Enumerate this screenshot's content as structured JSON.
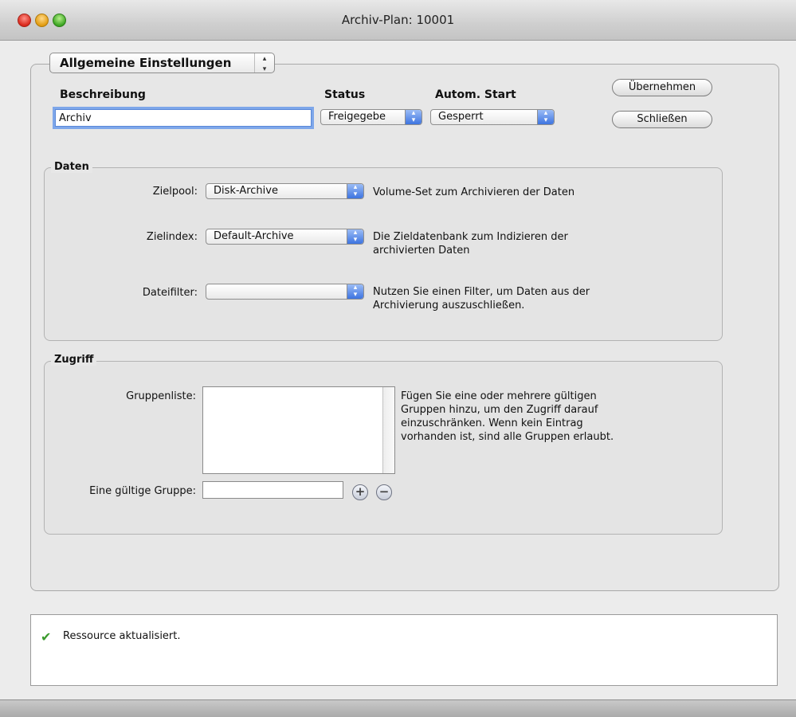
{
  "window": {
    "title": "Archiv-Plan: 10001"
  },
  "section_selector": {
    "value": "Allgemeine Einstellungen"
  },
  "general": {
    "description_label": "Beschreibung",
    "description_value": "Archiv",
    "status_label": "Status",
    "status_value": "Freigegebe",
    "autostart_label": "Autom. Start",
    "autostart_value": "Gesperrt",
    "apply_button": "Übernehmen",
    "close_button": "Schließen"
  },
  "daten": {
    "title": "Daten",
    "zielpool_label": "Zielpool:",
    "zielpool_value": "Disk-Archive",
    "zielpool_desc": "Volume-Set zum Archivieren der Daten",
    "zielindex_label": "Zielindex:",
    "zielindex_value": "Default-Archive",
    "zielindex_desc_line1": "Die Zieldatenbank zum Indizieren der",
    "zielindex_desc_line2": "archivierten Daten",
    "dateifilter_label": "Dateifilter:",
    "dateifilter_value": "",
    "dateifilter_desc_line1": "Nutzen Sie einen Filter, um Daten aus der",
    "dateifilter_desc_line2": "Archivierung auszuschließen."
  },
  "zugriff": {
    "title": "Zugriff",
    "gruppenliste_label": "Gruppenliste:",
    "desc_line1": "Fügen Sie eine oder mehrere gültigen",
    "desc_line2": "Gruppen hinzu, um den Zugriff darauf",
    "desc_line3": "einzuschränken. Wenn kein Eintrag",
    "desc_line4": "vorhanden ist, sind alle Gruppen erlaubt.",
    "group_input_label": "Eine gültige Gruppe:",
    "group_input_value": "",
    "add_symbol": "+",
    "remove_symbol": "−"
  },
  "status": {
    "icon": "checkmark-icon",
    "message": "Ressource aktualisiert."
  }
}
